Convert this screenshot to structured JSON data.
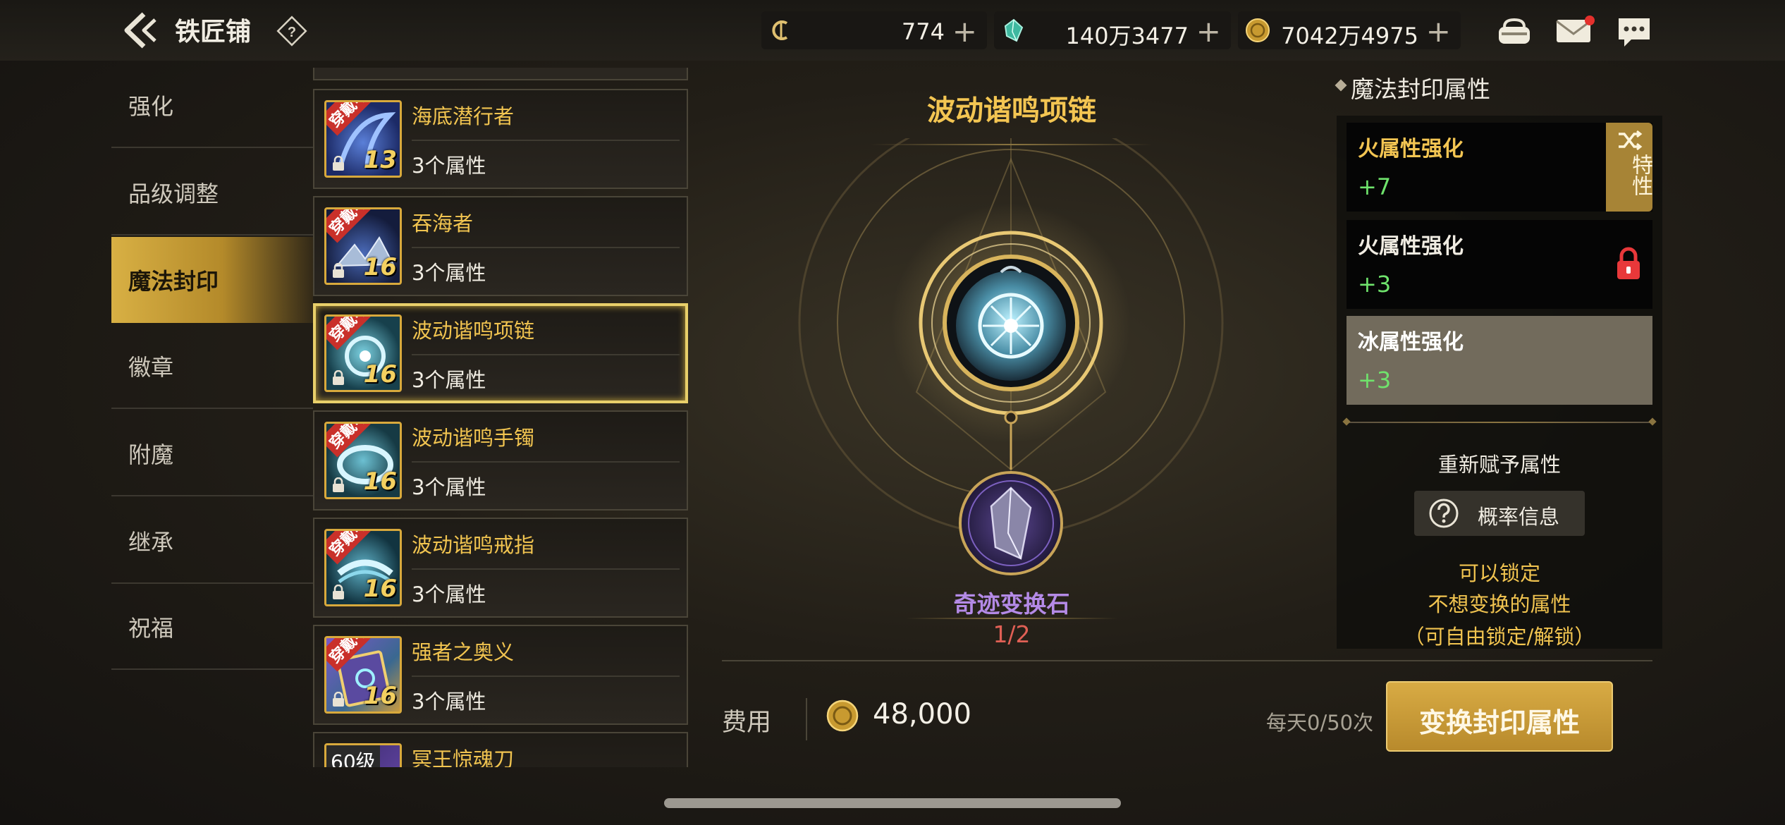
{
  "header": {
    "title": "铁匠铺",
    "currencies": [
      {
        "icon": "credit-coin-icon",
        "value": "774"
      },
      {
        "icon": "crystal-icon",
        "value": "140万3477"
      },
      {
        "icon": "gold-coin-icon",
        "value": "7042万4975"
      }
    ],
    "plus": "+",
    "help": "?"
  },
  "menu": {
    "items": [
      {
        "label": "强化"
      },
      {
        "label": "品级调整"
      },
      {
        "label": "魔法封印"
      },
      {
        "label": "徽章"
      },
      {
        "label": "附魔"
      },
      {
        "label": "继承"
      },
      {
        "label": "祝福"
      }
    ],
    "active_index": 2
  },
  "items": {
    "list": [
      {
        "name": "海底潜行者",
        "attrs": "3个属性",
        "level": "13",
        "badge": "穿戴中"
      },
      {
        "name": "吞海者",
        "attrs": "3个属性",
        "level": "16",
        "badge": "穿戴中"
      },
      {
        "name": "波动谐鸣项链",
        "attrs": "3个属性",
        "level": "16",
        "badge": "穿戴中"
      },
      {
        "name": "波动谐鸣手镯",
        "attrs": "3个属性",
        "level": "16",
        "badge": "穿戴中"
      },
      {
        "name": "波动谐鸣戒指",
        "attrs": "3个属性",
        "level": "16",
        "badge": "穿戴中"
      },
      {
        "name": "强者之奥义",
        "attrs": "3个属性",
        "level": "16",
        "badge": "穿戴中"
      },
      {
        "name": "冥王惊魂刀",
        "level_tag": "60级"
      }
    ],
    "selected_index": 2
  },
  "center": {
    "title": "波动谐鸣项链",
    "stone_name": "奇迹变换石",
    "stone_count": "1/2",
    "cost_label": "费用",
    "cost_value": "48,000",
    "daily": "每天0/50次",
    "convert_button": "变换封印属性"
  },
  "right": {
    "title": "魔法封印属性",
    "attributes": [
      {
        "name": "火属性强化",
        "value": "+7"
      },
      {
        "name": "火属性强化",
        "value": "+3"
      },
      {
        "name": "冰属性强化",
        "value": "+3"
      }
    ],
    "trait_label": "特性",
    "reassign": "重新赋予属性",
    "prob_button": "概率信息",
    "hint_lines": [
      "可以锁定",
      "不想变换的属性",
      "（可自由锁定/解锁）"
    ]
  },
  "colors": {
    "gold_accent": "#f3c552",
    "value_green": "#6fe36c",
    "stone_purple": "#b48ae6",
    "count_red": "#e06055",
    "active_menu": "#d8b044"
  }
}
